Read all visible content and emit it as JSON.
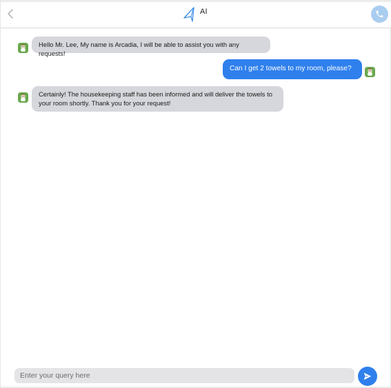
{
  "header": {
    "title": "AI",
    "back_icon": "chevron-left-icon",
    "logo_icon": "arcadia-logo-icon",
    "call_icon": "phone-icon"
  },
  "messages": [
    {
      "sender": "bot",
      "lines": [
        "Hello Mr. Lee, My name is Arcadia, I will be able to assist you with any requests!"
      ]
    },
    {
      "sender": "user",
      "lines": [
        "Can I get 2 towels to my room, please?"
      ]
    },
    {
      "sender": "bot",
      "lines": [
        "Certainly! The housekeeping staff has been informed and will deliver the towels to",
        "your room shortly. Thank you for your request!"
      ]
    }
  ],
  "composer": {
    "placeholder": "Enter your query here",
    "value": "",
    "send_icon": "send-icon"
  },
  "colors": {
    "user_bubble": "#2f80ed",
    "bot_bubble": "#d6d7dc",
    "call_button": "#a9cdf0",
    "avatar": "#6aa84f"
  }
}
